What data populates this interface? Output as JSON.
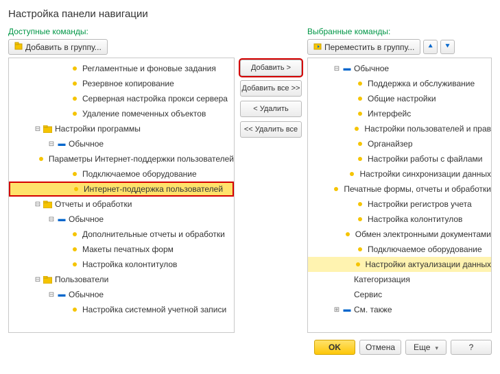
{
  "title": "Настройка панели навигации",
  "labels": {
    "available": "Доступные команды:",
    "selected": "Выбранные команды:"
  },
  "toolbar": {
    "add_to_group": "Добавить в группу...",
    "move_to_group": "Переместить в группу..."
  },
  "mid_buttons": {
    "add": "Добавить >",
    "add_all": "Добавить все >>",
    "remove": "< Удалить",
    "remove_all": "<< Удалить все"
  },
  "footer": {
    "ok": "OK",
    "cancel": "Отмена",
    "more": "Еще",
    "help": "?"
  },
  "left_tree": [
    {
      "depth": 2,
      "icon": "bullet",
      "label": "Регламентные и фоновые задания"
    },
    {
      "depth": 2,
      "icon": "bullet",
      "label": "Резервное копирование"
    },
    {
      "depth": 2,
      "icon": "bullet",
      "label": "Серверная настройка прокси сервера"
    },
    {
      "depth": 2,
      "icon": "bullet",
      "label": "Удаление помеченных объектов"
    },
    {
      "depth": 0,
      "toggle": "-",
      "icon": "folder",
      "label": "Настройки программы"
    },
    {
      "depth": 1,
      "toggle": "-",
      "icon": "group",
      "label": "Обычное"
    },
    {
      "depth": 2,
      "icon": "bullet",
      "label": "Параметры Интернет-поддержки пользователей"
    },
    {
      "depth": 2,
      "icon": "bullet",
      "label": "Подключаемое оборудование"
    },
    {
      "depth": 2,
      "icon": "bullet",
      "label": "Интернет-поддержка пользователей",
      "selected": true
    },
    {
      "depth": 0,
      "toggle": "-",
      "icon": "folder",
      "label": "Отчеты и обработки"
    },
    {
      "depth": 1,
      "toggle": "-",
      "icon": "group",
      "label": "Обычное"
    },
    {
      "depth": 2,
      "icon": "bullet",
      "label": "Дополнительные отчеты и обработки"
    },
    {
      "depth": 2,
      "icon": "bullet",
      "label": "Макеты печатных форм"
    },
    {
      "depth": 2,
      "icon": "bullet",
      "label": "Настройка колонтитулов"
    },
    {
      "depth": 0,
      "toggle": "-",
      "icon": "folder",
      "label": "Пользователи"
    },
    {
      "depth": 1,
      "toggle": "-",
      "icon": "group",
      "label": "Обычное"
    },
    {
      "depth": 2,
      "icon": "bullet",
      "label": "Настройка системной учетной записи"
    }
  ],
  "right_tree": [
    {
      "depth": 0,
      "toggle": "-",
      "icon": "group",
      "label": "Обычное"
    },
    {
      "depth": 1,
      "icon": "bullet",
      "label": "Поддержка и обслуживание"
    },
    {
      "depth": 1,
      "icon": "bullet",
      "label": "Общие настройки"
    },
    {
      "depth": 1,
      "icon": "bullet",
      "label": "Интерфейс"
    },
    {
      "depth": 1,
      "icon": "bullet",
      "label": "Настройки пользователей и прав"
    },
    {
      "depth": 1,
      "icon": "bullet",
      "label": "Органайзер"
    },
    {
      "depth": 1,
      "icon": "bullet",
      "label": "Настройки работы с файлами"
    },
    {
      "depth": 1,
      "icon": "bullet",
      "label": "Настройки синхронизации данных"
    },
    {
      "depth": 1,
      "icon": "bullet",
      "label": "Печатные формы, отчеты и обработки"
    },
    {
      "depth": 1,
      "icon": "bullet",
      "label": "Настройки регистров учета"
    },
    {
      "depth": 1,
      "icon": "bullet",
      "label": "Настройка колонтитулов"
    },
    {
      "depth": 1,
      "icon": "bullet",
      "label": "Обмен электронными документами"
    },
    {
      "depth": 1,
      "icon": "bullet",
      "label": "Подключаемое оборудование"
    },
    {
      "depth": 1,
      "icon": "bullet",
      "label": "Настройки актуализации данных",
      "highlight": true
    },
    {
      "depth": 0,
      "icon": "none",
      "label": "Категоризация"
    },
    {
      "depth": 0,
      "icon": "none",
      "label": "Сервис"
    },
    {
      "depth": 0,
      "toggle": "+",
      "icon": "group",
      "label": "См. также"
    }
  ]
}
